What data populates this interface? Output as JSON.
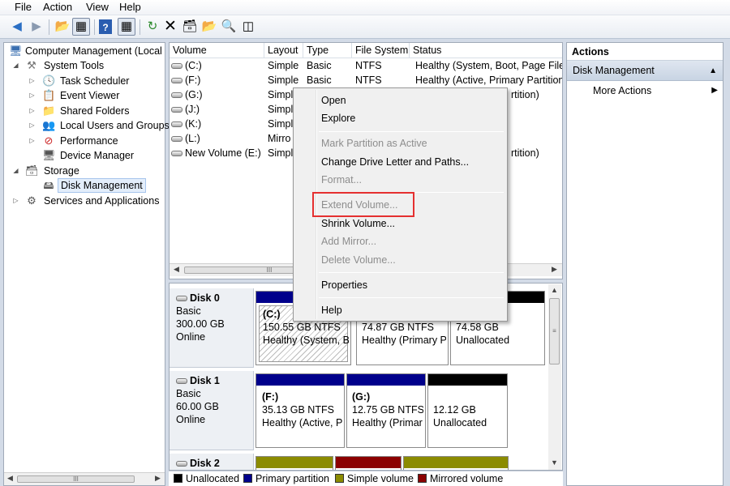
{
  "menu": [
    "File",
    "Action",
    "View",
    "Help"
  ],
  "toolbar": {
    "icons": [
      "back-icon",
      "forward-icon",
      "up-folder-icon",
      "show-hide-tree-icon",
      "help-icon",
      "show-hide-actions-icon",
      "refresh-icon",
      "delete-icon",
      "properties-icon",
      "open-folder-icon",
      "search-icon",
      "export-icon"
    ]
  },
  "tree": {
    "root": "Computer Management (Local",
    "system_tools": "System Tools",
    "task_scheduler": "Task Scheduler",
    "event_viewer": "Event Viewer",
    "shared_folders": "Shared Folders",
    "local_users": "Local Users and Groups",
    "performance": "Performance",
    "device_manager": "Device Manager",
    "storage": "Storage",
    "disk_management": "Disk Management",
    "services": "Services and Applications",
    "hscroll_thumb": "III"
  },
  "volumes": {
    "columns": [
      "Volume",
      "Layout",
      "Type",
      "File System",
      "Status"
    ],
    "rows": [
      {
        "volume": "(C:)",
        "layout": "Simple",
        "type": "Basic",
        "fs": "NTFS",
        "status": "Healthy (System, Boot, Page File, A"
      },
      {
        "volume": "(F:)",
        "layout": "Simple",
        "type": "Basic",
        "fs": "NTFS",
        "status": "Healthy (Active, Primary Partition)"
      },
      {
        "volume": "(G:)",
        "layout": "Simpl",
        "type": "",
        "fs": "",
        "status": "rtition)"
      },
      {
        "volume": "(J:)",
        "layout": "Simpl",
        "type": "",
        "fs": "",
        "status": ""
      },
      {
        "volume": "(K:)",
        "layout": "Simpl",
        "type": "",
        "fs": "",
        "status": ""
      },
      {
        "volume": "(L:)",
        "layout": "Mirro",
        "type": "",
        "fs": "",
        "status": ""
      },
      {
        "volume": "New Volume (E:)",
        "layout": "Simpl",
        "type": "",
        "fs": "",
        "status": "rtition)"
      }
    ],
    "hscroll_thumb": "III"
  },
  "disks": [
    {
      "name": "Disk 0",
      "type": "Basic",
      "size": "300.00 GB",
      "status": "Online"
    },
    {
      "name": "Disk 1",
      "type": "Basic",
      "size": "60.00 GB",
      "status": "Online"
    },
    {
      "name": "Disk 2"
    }
  ],
  "partitions": {
    "d0_c_name": "(C:)",
    "d0_c_size": "150.55 GB NTFS",
    "d0_c_status": "Healthy (System, Bo",
    "d0_p2_size": "74.87 GB NTFS",
    "d0_p2_status": "Healthy (Primary P",
    "d0_un_size": "74.58 GB",
    "d0_un_status": "Unallocated",
    "d1_f_name": "(F:)",
    "d1_f_size": "35.13 GB NTFS",
    "d1_f_status": "Healthy (Active, P",
    "d1_g_name": "(G:)",
    "d1_g_size": "12.75 GB NTFS",
    "d1_g_status": "Healthy (Primar",
    "d1_un_size": "12.12 GB",
    "d1_un_status": "Unallocated"
  },
  "legend": [
    {
      "label": "Unallocated",
      "color": "#000000"
    },
    {
      "label": "Primary partition",
      "color": "#00008b"
    },
    {
      "label": "Simple volume",
      "color": "#8b8b00"
    },
    {
      "label": "Mirrored volume",
      "color": "#8b0000"
    }
  ],
  "actions": {
    "header": "Actions",
    "section": "Disk Management",
    "more": "More Actions"
  },
  "context_menu": {
    "open": "Open",
    "explore": "Explore",
    "mark_active": "Mark Partition as Active",
    "change_letter": "Change Drive Letter and Paths...",
    "format": "Format...",
    "extend": "Extend Volume...",
    "shrink": "Shrink Volume...",
    "add_mirror": "Add Mirror...",
    "delete": "Delete Volume...",
    "properties": "Properties",
    "help": "Help"
  },
  "colors": {
    "primary": "#00008b",
    "unallocated": "#000000",
    "simple": "#8b8b00",
    "mirrored": "#8b0000",
    "highlight": "#e53030",
    "selection": "#e3eefb"
  }
}
